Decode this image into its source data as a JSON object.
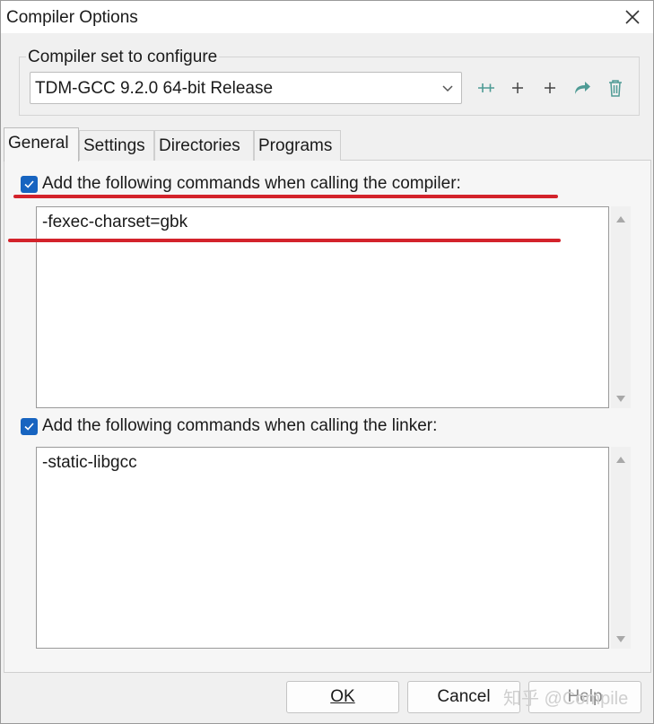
{
  "window": {
    "title": "Compiler Options"
  },
  "compiler_set": {
    "group_label": "Compiler set to configure",
    "selected": "TDM-GCC 9.2.0 64-bit Release",
    "toolbar_icons": [
      "add-folder-icon",
      "plus-icon",
      "plus-icon",
      "redo-icon",
      "trash-icon"
    ]
  },
  "tabs": [
    {
      "label": "General",
      "active": true
    },
    {
      "label": "Settings"
    },
    {
      "label": "Directories"
    },
    {
      "label": "Programs"
    }
  ],
  "general": {
    "compiler_cmd": {
      "checked": true,
      "label": "Add the following commands when calling the compiler:",
      "value": "-fexec-charset=gbk"
    },
    "linker_cmd": {
      "checked": true,
      "label": "Add the following commands when calling the linker:",
      "value": "-static-libgcc"
    }
  },
  "buttons": {
    "ok": "OK",
    "cancel": "Cancel",
    "help": "Help"
  },
  "watermark": "知乎 @Compile",
  "colors": {
    "accent": "#1764c0",
    "annotation_red": "#d3232b",
    "icon_teal": "#4f9b95"
  }
}
